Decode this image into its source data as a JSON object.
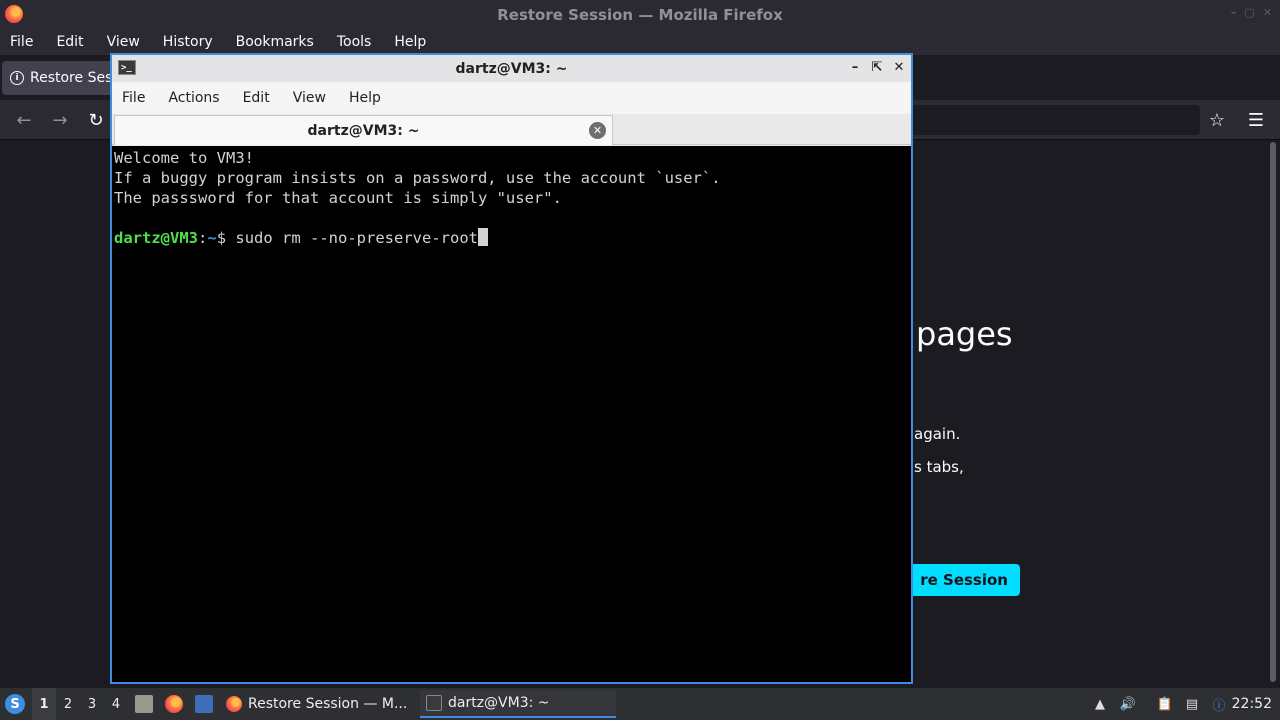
{
  "firefox": {
    "window_title": "Restore Session — Mozilla Firefox",
    "menu": [
      "File",
      "Edit",
      "View",
      "History",
      "Bookmarks",
      "Tools",
      "Help"
    ],
    "tab_label": "Restore Ses",
    "page": {
      "heading_visible": "pages",
      "para1_visible": "again.",
      "para2_visible": "s tabs,",
      "restore_button_visible": "re Session"
    },
    "colors": {
      "accent_button": "#00ddff",
      "background": "#1c1b22"
    }
  },
  "terminal": {
    "title": "dartz@VM3: ~",
    "menu": [
      "File",
      "Actions",
      "Edit",
      "View",
      "Help"
    ],
    "tab_label": "dartz@VM3: ~",
    "lines": [
      "Welcome to VM3!",
      "If a buggy program insists on a password, use the account `user`.",
      "The passsword for that account is simply \"user\".",
      ""
    ],
    "prompt": {
      "user_host": "dartz@VM3",
      "sep": ":",
      "path": "~",
      "symbol": "$ ",
      "command": "sudo rm --no-preserve-root"
    }
  },
  "taskbar": {
    "workspaces": [
      "1",
      "2",
      "3",
      "4"
    ],
    "tasks": [
      {
        "label": "Restore Session — M..."
      },
      {
        "label": "dartz@VM3: ~"
      }
    ],
    "clock": "22:52"
  }
}
